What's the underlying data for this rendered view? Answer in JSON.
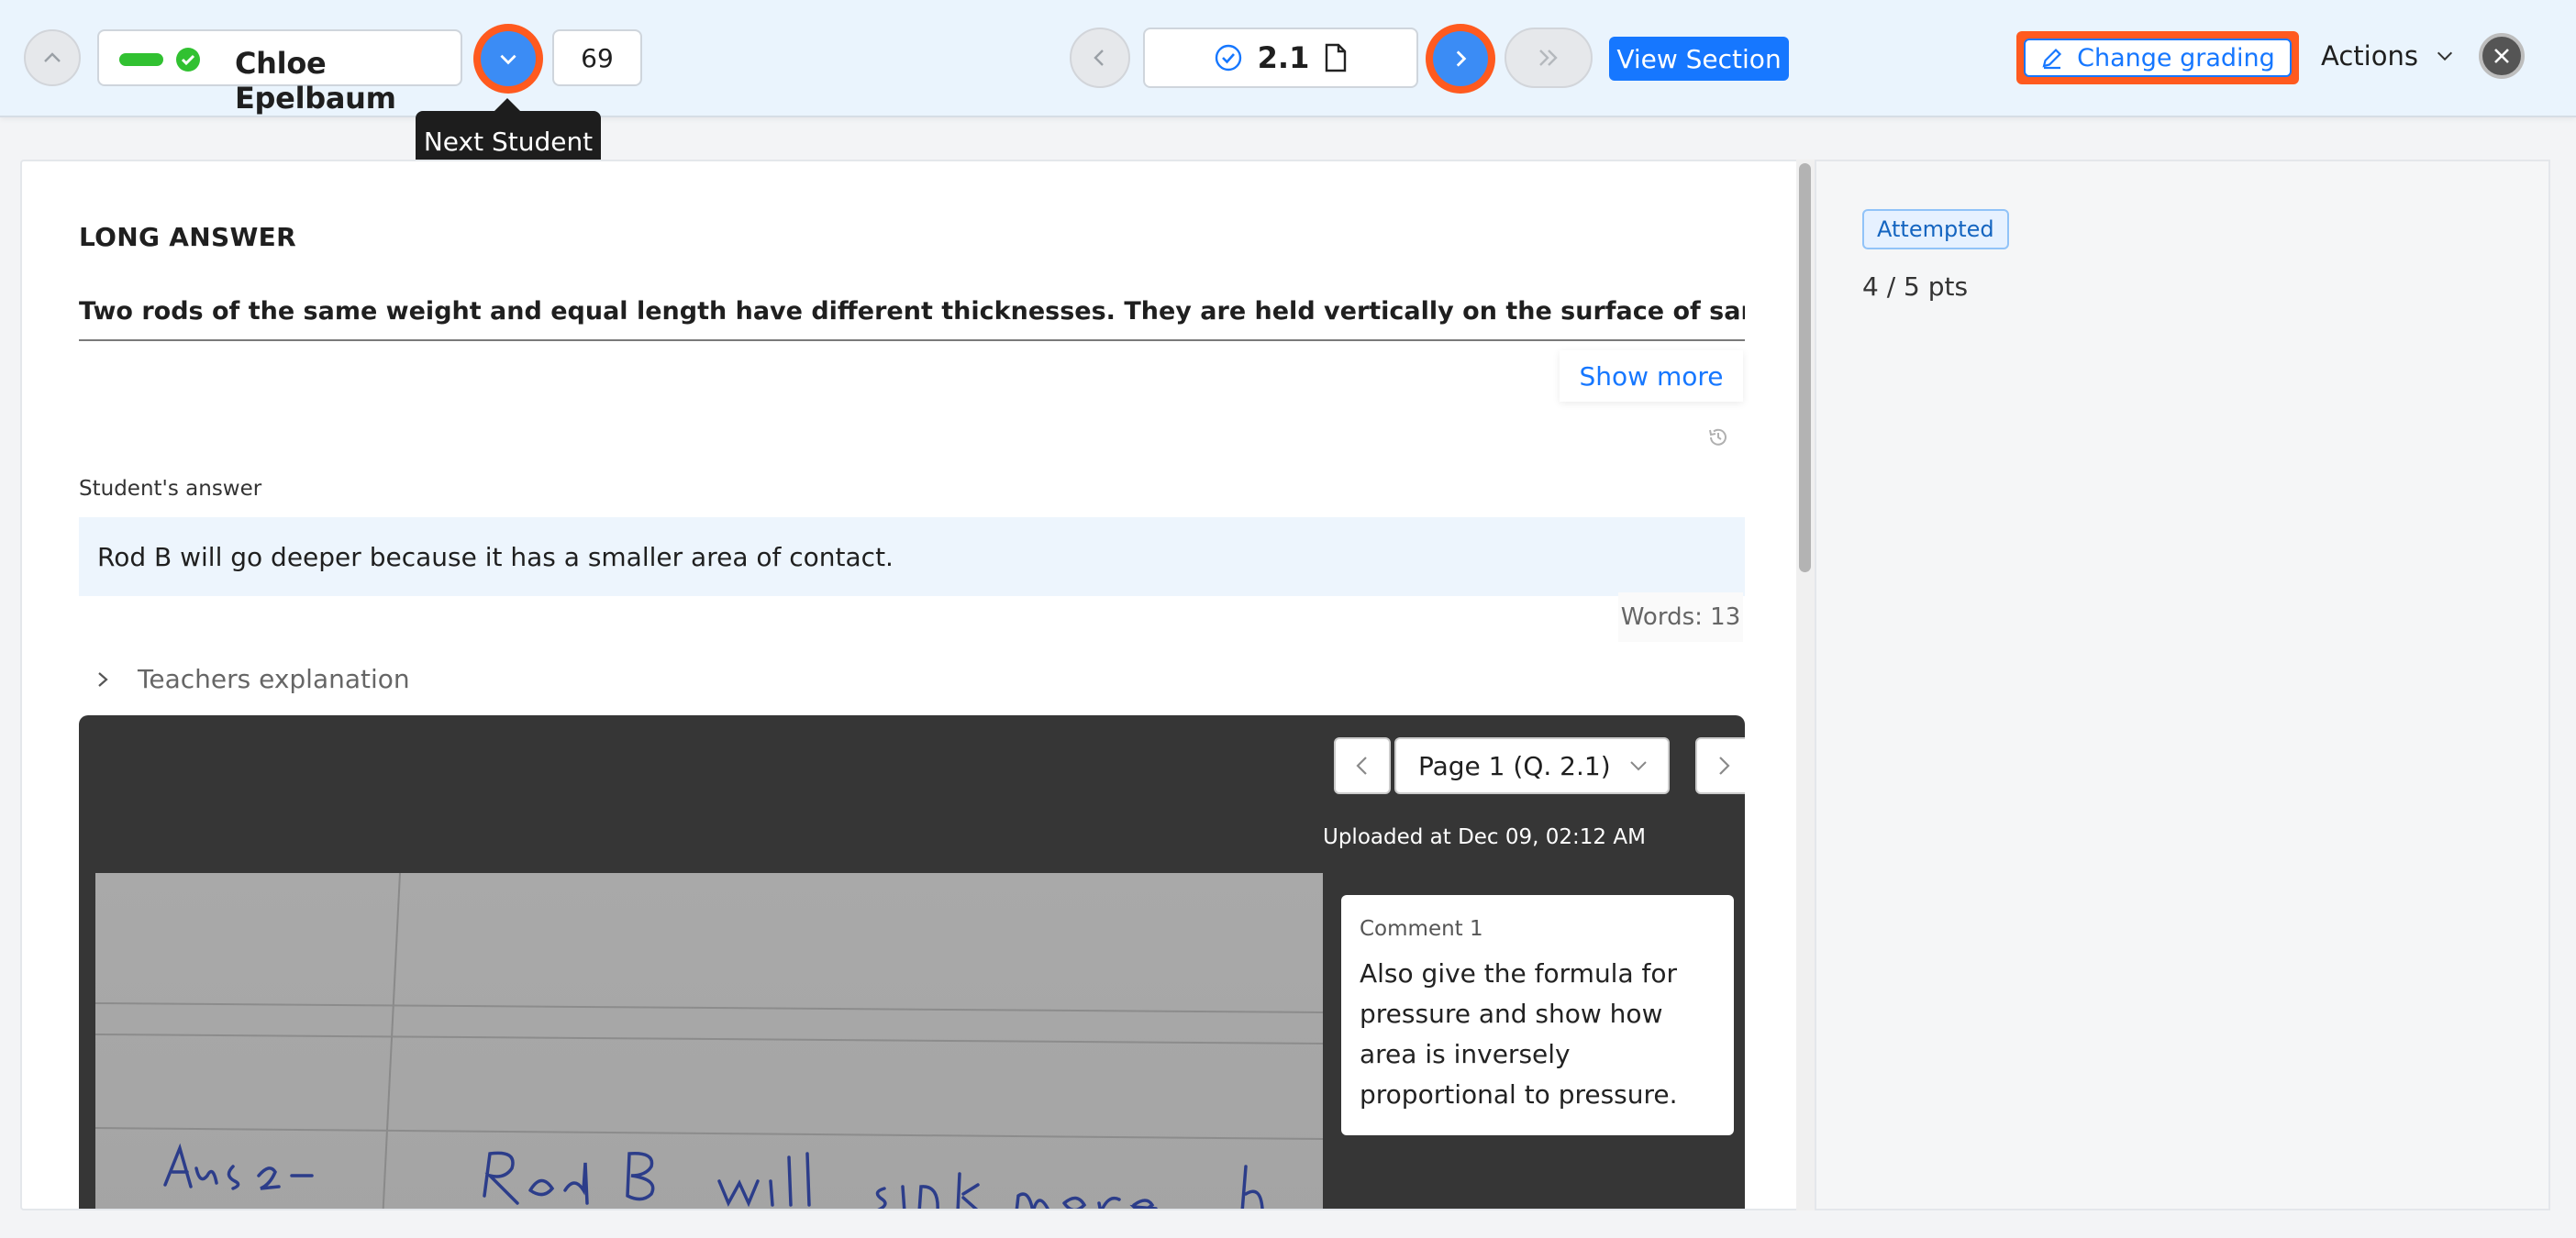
{
  "header": {
    "student_name": "Chloe Epelbaum",
    "student_number": "69",
    "tooltip": "Next Student",
    "question_number": "2.1",
    "view_section_label": "View Section",
    "change_grading_label": "Change grading",
    "actions_label": "Actions"
  },
  "question": {
    "type": "LONG ANSWER",
    "text": "Two rods of the same weight and equal length have different thicknesses. They are held vertically on the surface of sand as shown in the",
    "show_more": "Show more"
  },
  "answer": {
    "label": "Student's answer",
    "text": "Rod B will go deeper because it has a smaller area of contact.",
    "words": "Words: 13"
  },
  "teachers_explanation": "Teachers explanation",
  "viewer": {
    "page_select": "Page 1 (Q. 2.1)",
    "uploaded": "Uploaded at Dec 09, 02:12 AM",
    "comment_title": "Comment 1",
    "comment_body": "Also give the formula for pressure and show how area is inversely proportional to pressure."
  },
  "grading": {
    "status": "Attempted",
    "score": "4 / 5 pts"
  },
  "colors": {
    "accent": "#1677ff",
    "highlight": "#ff5a1f",
    "success": "#31c131"
  }
}
